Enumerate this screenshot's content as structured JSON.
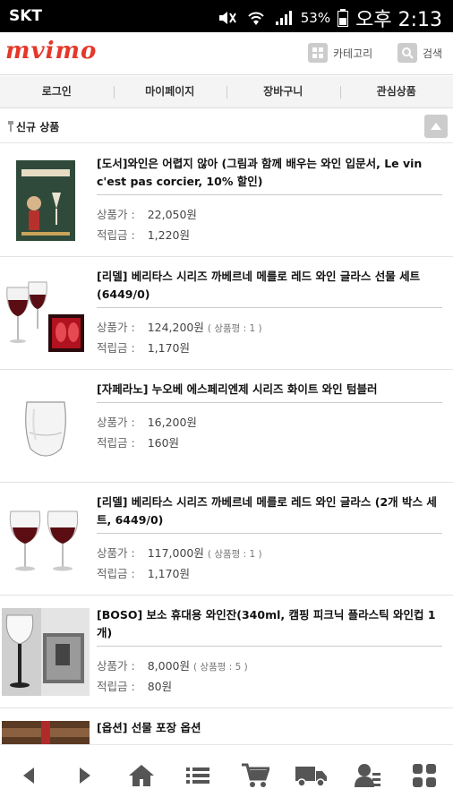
{
  "status_bar": {
    "carrier": "SKT",
    "battery": "53%",
    "time": "오후 2:13"
  },
  "header": {
    "logo": "mvimo",
    "category_label": "카테고리",
    "search_label": "검색"
  },
  "nav": {
    "items": [
      "로그인",
      "마이페이지",
      "장바구니",
      "관심상품"
    ]
  },
  "section": {
    "title": "신규 상품"
  },
  "labels": {
    "price": "상품가 :",
    "points": "적립금 :"
  },
  "products": [
    {
      "name": "[도서]와인은 어렵지 않아 (그림과 함께 배우는 와인 입문서, Le vin c'est pas corcier, 10% 할인)",
      "price": "22,050원",
      "reviews": "",
      "points": "1,220원",
      "thumb": "book"
    },
    {
      "name": "[리델] 베리타스 시리즈 까베르네 메를로 레드 와인 글라스 선물 세트(6449/0)",
      "price": "124,200원",
      "reviews": "( 상품평 : 1 )",
      "points": "1,170원",
      "thumb": "glass-box"
    },
    {
      "name": "[자페라노] 누오베 에스페리엔제 시리즈 화이트 와인 텀블러",
      "price": "16,200원",
      "reviews": "",
      "points": "160원",
      "thumb": "tumbler"
    },
    {
      "name": "[리델] 베리타스 시리즈 까베르네 메를로 레드 와인 글라스 (2개 박스 세트, 6449/0)",
      "price": "117,000원",
      "reviews": "( 상품평 : 1 )",
      "points": "1,170원",
      "thumb": "two-glasses"
    },
    {
      "name": "[BOSO] 보소 휴대용 와인잔(340ml, 캠핑 피크닉 플라스틱 와인컵 1개)",
      "price": "8,000원",
      "reviews": "( 상품평 : 5 )",
      "points": "80원",
      "thumb": "plastic-glass"
    },
    {
      "name": "[옵션] 선물 포장 옵션",
      "thumb": "gift-wrap"
    }
  ],
  "colors": {
    "brand": "#e4382a",
    "statusbar_bg": "#000000",
    "nav_bg": "#f4f4f4",
    "icon_gray": "#555555"
  },
  "bottom_nav": {
    "icons": [
      "back-icon",
      "forward-icon",
      "home-icon",
      "menu-list-icon",
      "cart-icon",
      "delivery-truck-icon",
      "my-account-icon",
      "grid-icon"
    ]
  }
}
